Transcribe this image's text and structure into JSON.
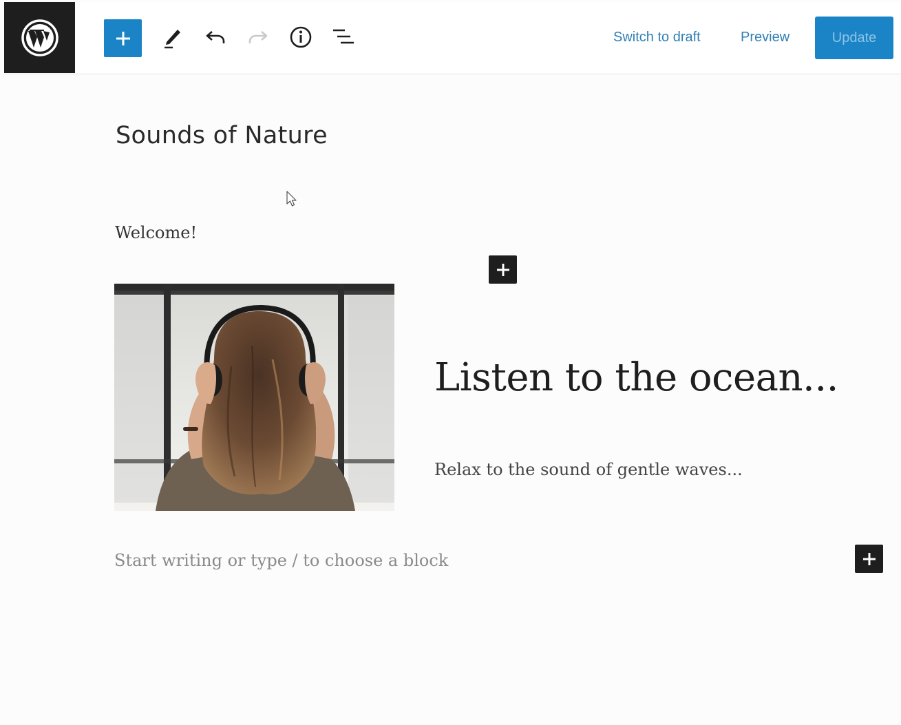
{
  "toolbar": {
    "logo_icon": "wordpress-logo-icon",
    "add_block_icon": "plus-icon",
    "tools_icon": "pencil-icon",
    "undo_icon": "undo-icon",
    "redo_icon": "redo-icon",
    "details_icon": "info-icon",
    "outline_icon": "list-view-icon",
    "switch_to_draft_label": "Switch to draft",
    "preview_label": "Preview",
    "update_label": "Update",
    "accent_color": "#1b84c6"
  },
  "editor": {
    "post_title": "Sounds of Nature",
    "paragraph_welcome": "Welcome!",
    "media_text": {
      "image_description": "woman-wearing-headphones-photo",
      "heading": "Listen to the ocean...",
      "paragraph": "Relax to the sound of gentle waves..."
    },
    "empty_block_placeholder": "Start writing or type / to choose a block"
  }
}
